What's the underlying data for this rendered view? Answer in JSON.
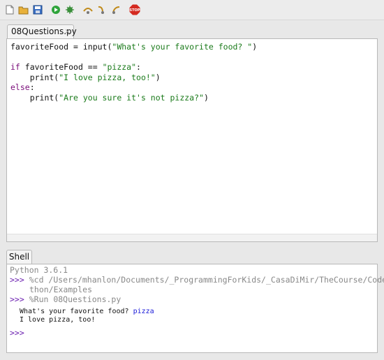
{
  "toolbar": {
    "icons": [
      "new-file-icon",
      "open-file-icon",
      "save-icon",
      "run-icon",
      "debug-icon",
      "step-over-icon",
      "step-into-icon",
      "step-out-icon",
      "stop-icon"
    ],
    "stop_label": "STOP"
  },
  "editor": {
    "tab_label": "08Questions.py",
    "tab_close": "×",
    "code": {
      "l1_a": "favoriteFood = input(",
      "l1_str": "\"What's your favorite food? \"",
      "l1_b": ")",
      "l3_kw": "if",
      "l3_a": " favoriteFood == ",
      "l3_str": "\"pizza\"",
      "l3_b": ":",
      "l4_a": "    print(",
      "l4_str": "\"I love pizza, too!\"",
      "l4_b": ")",
      "l5_kw": "else",
      "l5_b": ":",
      "l6_a": "    print(",
      "l6_str": "\"Are you sure it's not pizza?\"",
      "l6_b": ")"
    }
  },
  "shell": {
    "tab_label": "Shell",
    "version": "Python 3.6.1",
    "prompt": ">>>",
    "cd_cmd_1": "%cd /Users/mhanlon/Documents/_ProgrammingForKids/_CasaDiMir/TheCourse/Code/Py",
    "cd_cmd_2": "thon/Examples",
    "run_cmd": "%Run 08Questions.py",
    "question": "What's your favorite food? ",
    "user_input": "pizza",
    "answer": "I love pizza, too!"
  }
}
